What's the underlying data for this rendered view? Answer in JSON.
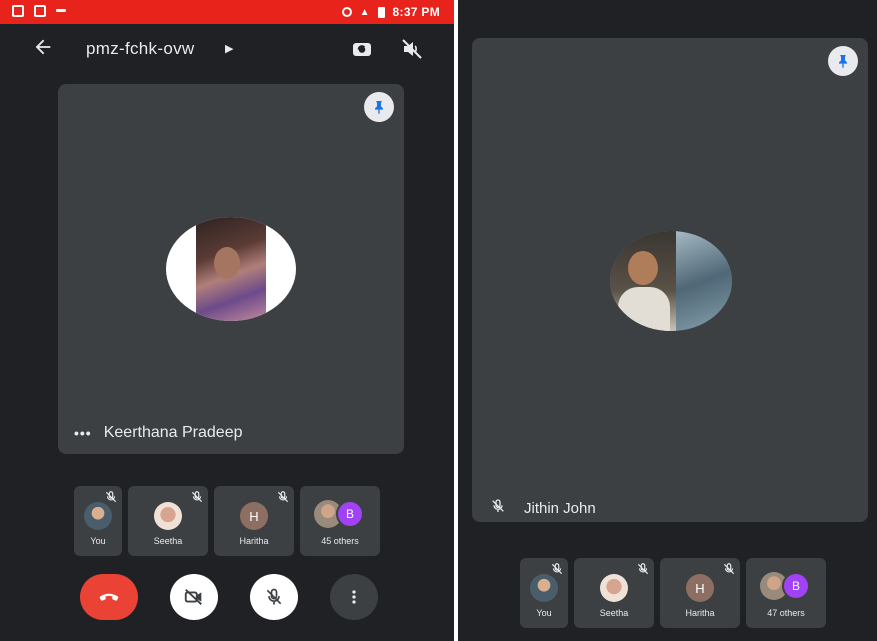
{
  "left": {
    "status": {
      "time": "8:37 PM"
    },
    "meeting_code": "pmz-fchk-ovw",
    "main_speaker": "Keerthana Pradeep",
    "participants": [
      {
        "label": "You"
      },
      {
        "label": "Seetha"
      },
      {
        "label": "Haritha",
        "initial": "H"
      },
      {
        "label": "45 others",
        "initial": "B"
      }
    ]
  },
  "right": {
    "main_speaker": "Jithin John",
    "participants": [
      {
        "label": "You"
      },
      {
        "label": "Seetha"
      },
      {
        "label": "Haritha",
        "initial": "H"
      },
      {
        "label": "47 others",
        "initial": "B"
      }
    ]
  },
  "colors": {
    "background": "#202124",
    "tile": "#3c4043",
    "status_bar": "#e8231b",
    "end_call": "#ea4335",
    "purple_avatar": "#a142f4",
    "brown_avatar": "#8d6e63",
    "pin_icon": "#1a73e8"
  },
  "icons": {
    "back": "arrow-left-icon",
    "switch_camera": "switch-camera-icon",
    "audio": "speaker-off-icon",
    "pin": "pin-icon",
    "mic_off": "mic-off-icon",
    "more": "more-vert-icon",
    "end_call": "call-end-icon",
    "camera_off": "camera-off-icon"
  }
}
